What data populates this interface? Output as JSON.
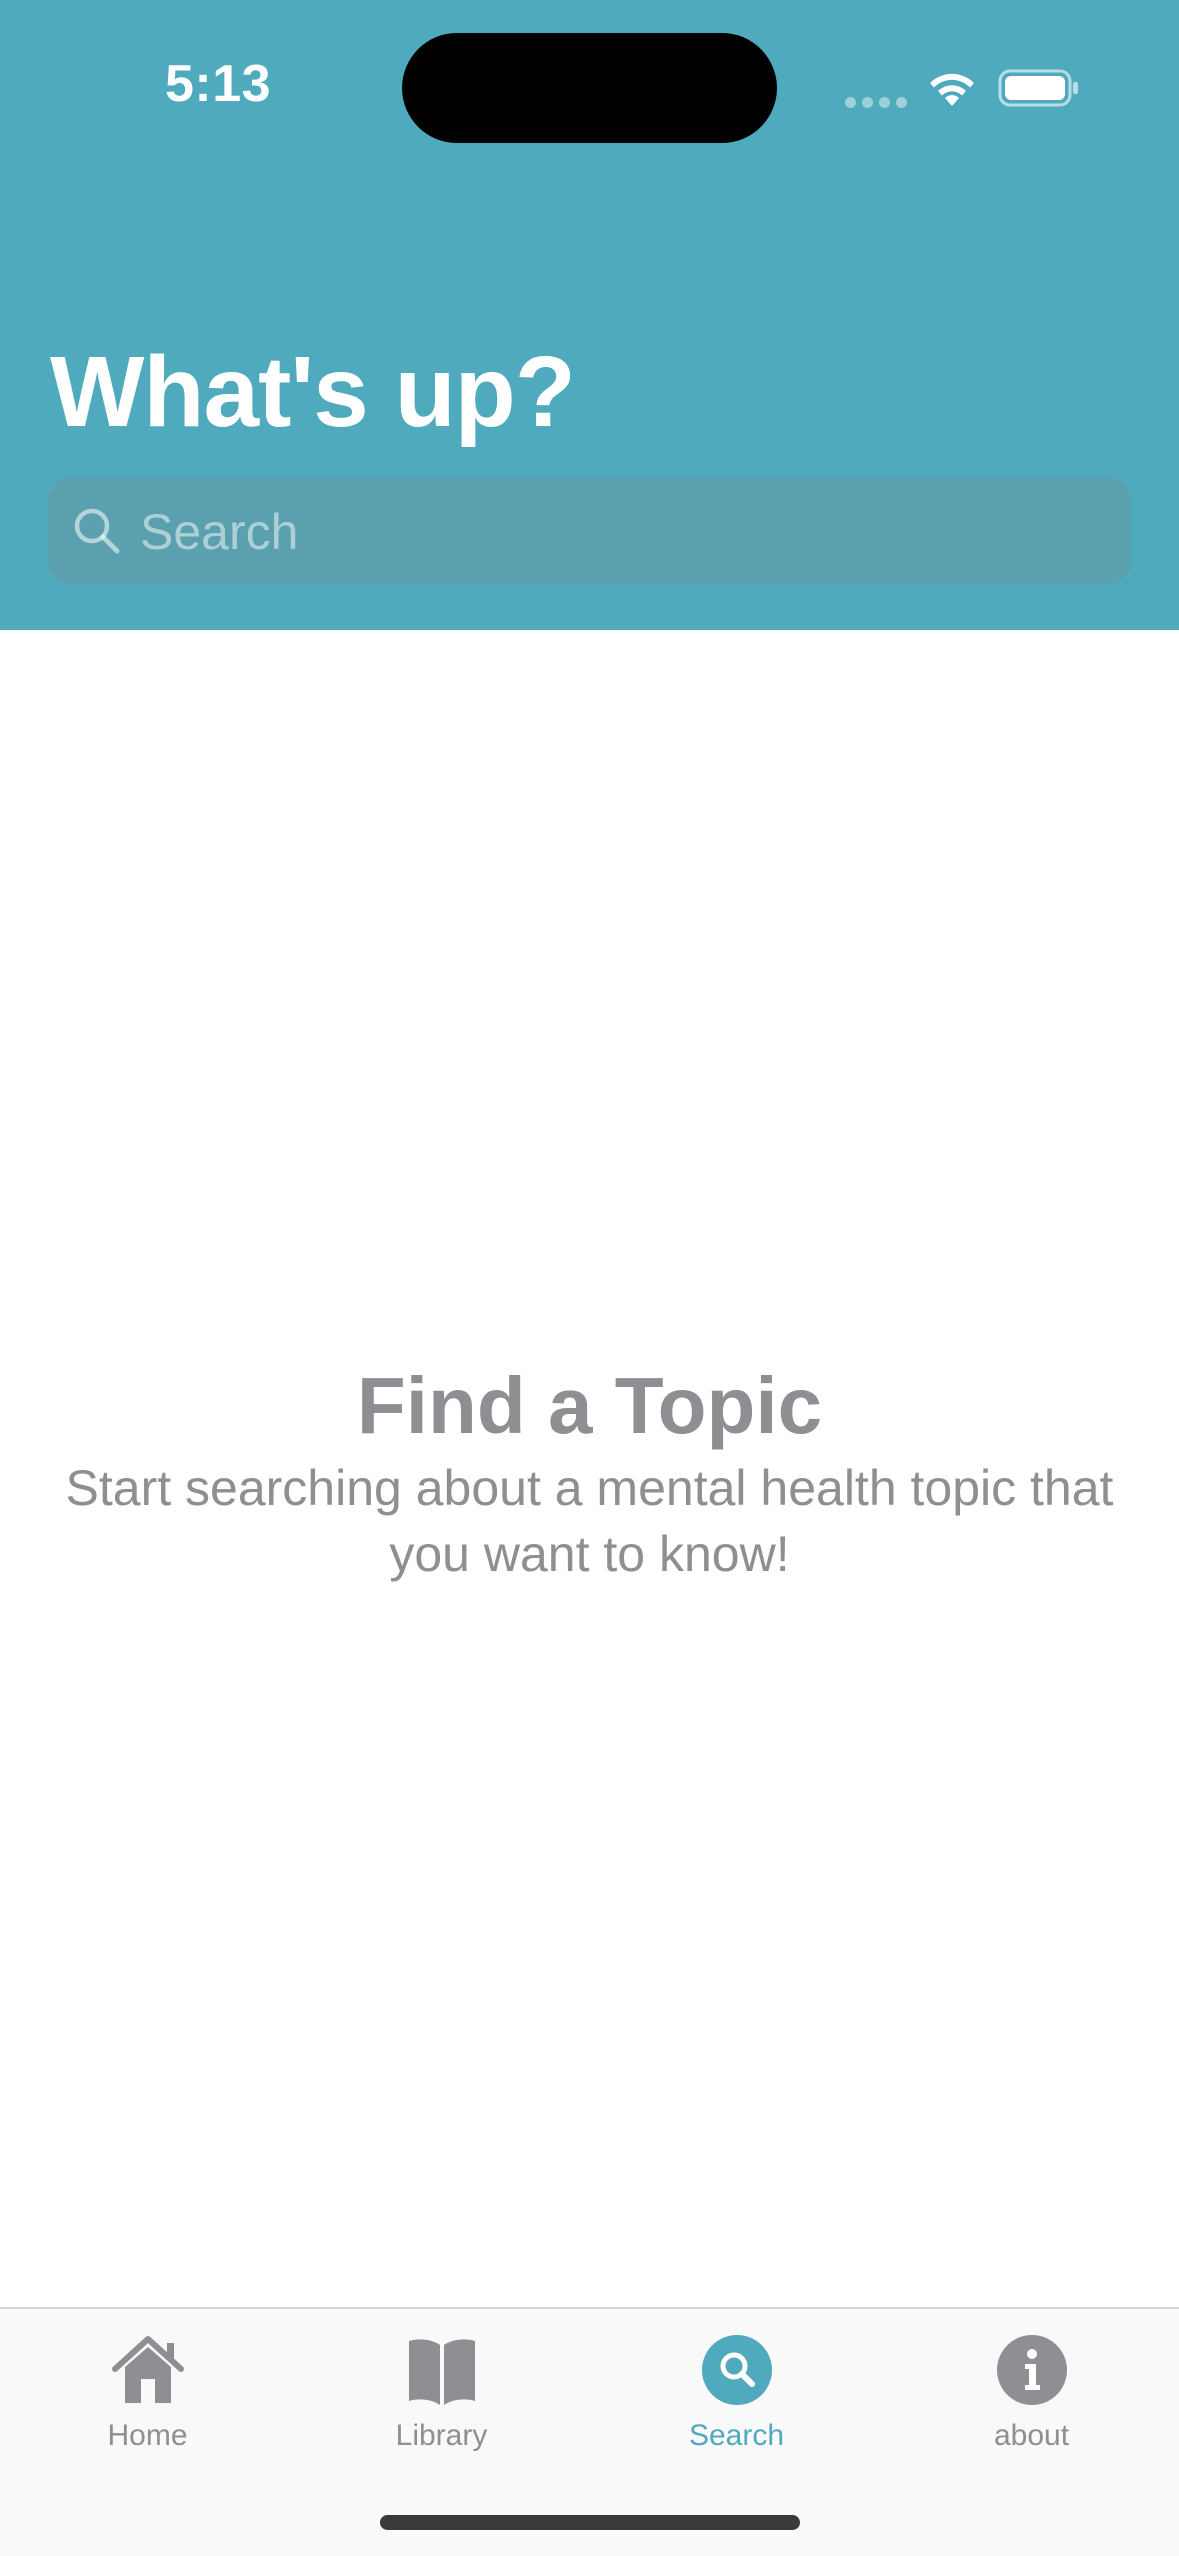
{
  "status_bar": {
    "time": "5:13"
  },
  "header": {
    "title": "What's up?",
    "background_color": "#4eaabc"
  },
  "search": {
    "placeholder": "Search",
    "icon": "magnifying-glass"
  },
  "empty_state": {
    "title": "Find a Topic",
    "subtitle": "Start searching about a mental health topic that you want to know!"
  },
  "tab_bar": {
    "active_color": "#4eaabc",
    "inactive_color": "#8e8e93",
    "tabs": [
      {
        "label": "Home",
        "icon": "house-icon",
        "active": false
      },
      {
        "label": "Library",
        "icon": "book-icon",
        "active": false
      },
      {
        "label": "Search",
        "icon": "search-circle-icon",
        "active": true
      },
      {
        "label": "about",
        "icon": "info-circle-icon",
        "active": false
      }
    ]
  }
}
